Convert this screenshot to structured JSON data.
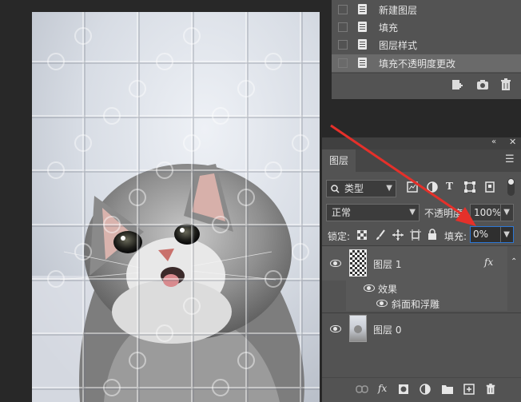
{
  "history": {
    "items": [
      {
        "label": "新建图层",
        "selected": false
      },
      {
        "label": "填充",
        "selected": false
      },
      {
        "label": "图层样式",
        "selected": false
      },
      {
        "label": "填充不透明度更改",
        "selected": true
      }
    ]
  },
  "layers_panel": {
    "tab_label": "图层",
    "filter_label": "类型",
    "blend_mode": "正常",
    "opacity_label": "不透明度:",
    "opacity_value": "100%",
    "lock_label": "锁定:",
    "fill_label": "填充:",
    "fill_value": "0%",
    "layers": [
      {
        "name": "图层 1",
        "fx_badge": "fx",
        "effects_label": "效果",
        "effect_item": "斜面和浮雕"
      },
      {
        "name": "图层 0"
      }
    ],
    "bottom_fx_label": "fx"
  },
  "canvas": {
    "image_subject": "grey kitten with puzzle-piece emboss overlay"
  },
  "annotation": {
    "arrow_color": "#e5302a"
  },
  "colors": {
    "panel_bg": "#535353",
    "selected_row": "#6a6a6a",
    "focus_border": "#2d78d6"
  }
}
